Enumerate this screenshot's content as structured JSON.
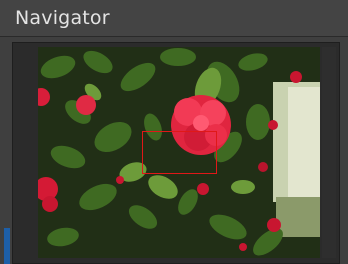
{
  "panel": {
    "title": "Navigator"
  },
  "thumbnail": {
    "description_icon": "photo-thumbnail-icon"
  },
  "colors": {
    "view_rect": "#e01818",
    "panel_bg": "#3f3f3f",
    "title_bg": "#444444"
  }
}
